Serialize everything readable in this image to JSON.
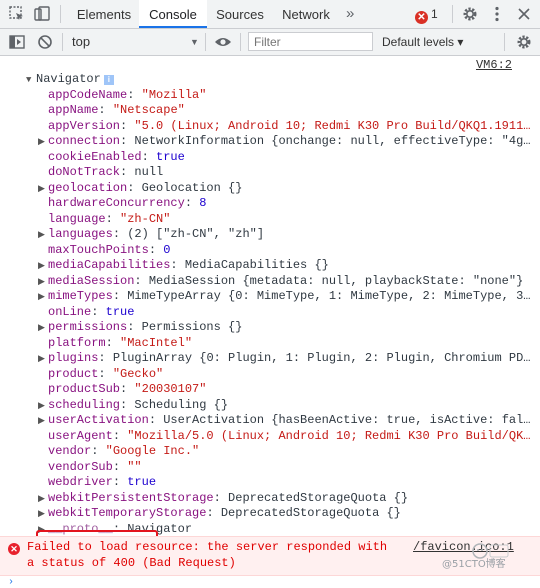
{
  "tabs": [
    "Elements",
    "Console",
    "Sources",
    "Network"
  ],
  "active_tab": "Console",
  "more_tabs_label": "»",
  "error_count": "1",
  "toolbar": {
    "context": "top",
    "filter_placeholder": "Filter",
    "levels_label": "Default levels ▾"
  },
  "source_link": "VM6:2",
  "navigator": {
    "title": "Navigator",
    "info_badge": "i",
    "props": [
      {
        "key": "appCodeName",
        "value": "\"Mozilla\"",
        "kind": "string",
        "expand": false
      },
      {
        "key": "appName",
        "value": "\"Netscape\"",
        "kind": "string",
        "expand": false
      },
      {
        "key": "appVersion",
        "value": "\"5.0 (Linux; Android 10; Redmi K30 Pro Build/QKQ1.1911…",
        "kind": "string",
        "expand": false
      },
      {
        "key": "connection",
        "value": "NetworkInformation {onchange: null, effectiveType: \"4g…",
        "kind": "object",
        "expand": true
      },
      {
        "key": "cookieEnabled",
        "value": "true",
        "kind": "bool",
        "expand": false
      },
      {
        "key": "doNotTrack",
        "value": "null",
        "kind": "null",
        "expand": false
      },
      {
        "key": "geolocation",
        "value": "Geolocation {}",
        "kind": "object",
        "expand": true
      },
      {
        "key": "hardwareConcurrency",
        "value": "8",
        "kind": "number",
        "expand": false
      },
      {
        "key": "language",
        "value": "\"zh-CN\"",
        "kind": "string",
        "expand": false
      },
      {
        "key": "languages",
        "value": "(2) [\"zh-CN\", \"zh\"]",
        "kind": "array",
        "expand": true
      },
      {
        "key": "maxTouchPoints",
        "value": "0",
        "kind": "number",
        "expand": false
      },
      {
        "key": "mediaCapabilities",
        "value": "MediaCapabilities {}",
        "kind": "object",
        "expand": true
      },
      {
        "key": "mediaSession",
        "value": "MediaSession {metadata: null, playbackState: \"none\"}",
        "kind": "object",
        "expand": true
      },
      {
        "key": "mimeTypes",
        "value": "MimeTypeArray {0: MimeType, 1: MimeType, 2: MimeType, 3…",
        "kind": "object",
        "expand": true
      },
      {
        "key": "onLine",
        "value": "true",
        "kind": "bool",
        "expand": false
      },
      {
        "key": "permissions",
        "value": "Permissions {}",
        "kind": "object",
        "expand": true
      },
      {
        "key": "platform",
        "value": "\"MacIntel\"",
        "kind": "string",
        "expand": false
      },
      {
        "key": "plugins",
        "value": "PluginArray {0: Plugin, 1: Plugin, 2: Plugin, Chromium PD…",
        "kind": "object",
        "expand": true
      },
      {
        "key": "product",
        "value": "\"Gecko\"",
        "kind": "string",
        "expand": false
      },
      {
        "key": "productSub",
        "value": "\"20030107\"",
        "kind": "string",
        "expand": false
      },
      {
        "key": "scheduling",
        "value": "Scheduling {}",
        "kind": "object",
        "expand": true
      },
      {
        "key": "userActivation",
        "value": "UserActivation {hasBeenActive: true, isActive: fal…",
        "kind": "object",
        "expand": true
      },
      {
        "key": "userAgent",
        "value": "\"Mozilla/5.0 (Linux; Android 10; Redmi K30 Pro Build/QK…",
        "kind": "string",
        "expand": false
      },
      {
        "key": "vendor",
        "value": "\"Google Inc.\"",
        "kind": "string",
        "expand": false
      },
      {
        "key": "vendorSub",
        "value": "\"\"",
        "kind": "string",
        "expand": false
      },
      {
        "key": "webdriver",
        "value": "true",
        "kind": "bool",
        "expand": false
      },
      {
        "key": "webkitPersistentStorage",
        "value": "DeprecatedStorageQuota {}",
        "kind": "object",
        "expand": true
      },
      {
        "key": "webkitTemporaryStorage",
        "value": "DeprecatedStorageQuota {}",
        "kind": "object",
        "expand": true
      },
      {
        "key": "__proto__",
        "value": "Navigator",
        "kind": "proto",
        "expand": true
      }
    ]
  },
  "error_message": {
    "text": "Failed to load resource: the server responded with a status of 400 (Bad Request)",
    "source": "/favicon.ico:1"
  },
  "watermark": "@51CTO博客",
  "colors": {
    "accent": "#1a73e8",
    "key": "#881280",
    "string": "#c41a16",
    "number": "#1c00cf",
    "error": "#e00000",
    "highlight_box": "#e3141e"
  }
}
